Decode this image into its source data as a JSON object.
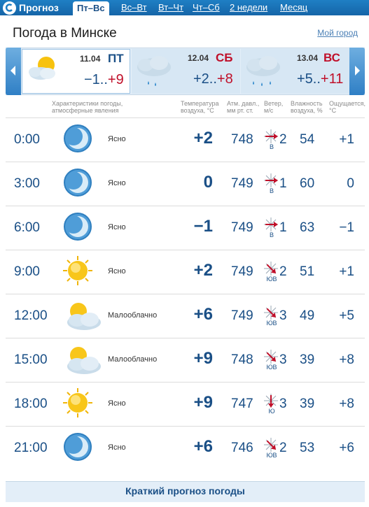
{
  "nav": {
    "brand": "Прогноз",
    "tabs": [
      "Пт–Вс",
      "Вс–Вт",
      "Вт–Чт",
      "Чт–Сб",
      "2 недели",
      "Месяц"
    ]
  },
  "header": {
    "title": "Погода в Минске",
    "my_city": "Мой город"
  },
  "days": [
    {
      "date": "11.04",
      "name": "ПТ",
      "lo": "−1..",
      "hi": "+9",
      "icon": "partly-cloudy"
    },
    {
      "date": "12.04",
      "name": "СБ",
      "lo": "+2..",
      "hi": "+8",
      "icon": "rain-cloud"
    },
    {
      "date": "13.04",
      "name": "ВС",
      "lo": "+5..",
      "hi": "+11",
      "icon": "rain-cloud"
    }
  ],
  "columns": {
    "conditions": "Характеристики погоды, атмосферные явления",
    "temp": "Температура воздуха, °С",
    "pressure": "Атм. давл., мм рт. ст.",
    "wind": "Ветер, м/с",
    "humidity": "Влажность воздуха, %",
    "feels": "Ощущается, °С"
  },
  "rows": [
    {
      "time": "0:00",
      "icon": "moon",
      "desc": "Ясно",
      "temp": "+2",
      "press": "748",
      "wdir": "В",
      "wspeed": "2",
      "hum": "54",
      "feel": "+1"
    },
    {
      "time": "3:00",
      "icon": "moon",
      "desc": "Ясно",
      "temp": "0",
      "press": "749",
      "wdir": "В",
      "wspeed": "1",
      "hum": "60",
      "feel": "0"
    },
    {
      "time": "6:00",
      "icon": "moon",
      "desc": "Ясно",
      "temp": "−1",
      "press": "749",
      "wdir": "В",
      "wspeed": "1",
      "hum": "63",
      "feel": "−1"
    },
    {
      "time": "9:00",
      "icon": "sun",
      "desc": "Ясно",
      "temp": "+2",
      "press": "749",
      "wdir": "ЮВ",
      "wspeed": "2",
      "hum": "51",
      "feel": "+1"
    },
    {
      "time": "12:00",
      "icon": "sun-cloud",
      "desc": "Малооблачно",
      "temp": "+6",
      "press": "749",
      "wdir": "ЮВ",
      "wspeed": "3",
      "hum": "49",
      "feel": "+5"
    },
    {
      "time": "15:00",
      "icon": "sun-cloud",
      "desc": "Малооблачно",
      "temp": "+9",
      "press": "748",
      "wdir": "ЮВ",
      "wspeed": "3",
      "hum": "39",
      "feel": "+8"
    },
    {
      "time": "18:00",
      "icon": "sun",
      "desc": "Ясно",
      "temp": "+9",
      "press": "747",
      "wdir": "Ю",
      "wspeed": "3",
      "hum": "39",
      "feel": "+8"
    },
    {
      "time": "21:00",
      "icon": "moon",
      "desc": "Ясно",
      "temp": "+6",
      "press": "746",
      "wdir": "ЮВ",
      "wspeed": "2",
      "hum": "53",
      "feel": "+6"
    }
  ],
  "footer": {
    "link": "Краткий прогноз погоды"
  },
  "colors": {
    "nav": "#1565a8",
    "accent": "#1a4f86",
    "hi": "#c0102a",
    "strip": "#e3eef8"
  }
}
